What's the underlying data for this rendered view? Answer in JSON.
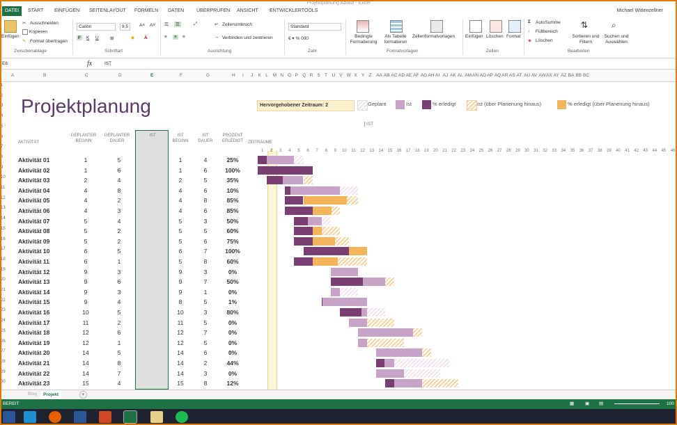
{
  "window": {
    "title": "Projektplanung Ablauf - Excel"
  },
  "tabs": [
    "DATEI",
    "START",
    "EINFÜGEN",
    "SEITENLAYOUT",
    "FORMELN",
    "DATEN",
    "ÜBERPRÜFEN",
    "ANSICHT",
    "ENTWICKLERTOOLS"
  ],
  "user": "Michael Wittenzellner",
  "ribbon": {
    "paste": "Einfügen",
    "cut": "Ausschneiden",
    "copy": "Kopieren",
    "format_painter": "Format übertragen",
    "group_clipboard": "Zwischenablage",
    "font_name": "Calibri",
    "font_size": "9,5",
    "group_font": "Schriftart",
    "wrap": "Zeilenumbruch",
    "merge": "Verbinden und zentrieren",
    "group_align": "Ausrichtung",
    "number_format": "Standard",
    "group_number": "Zahl",
    "cond_format": "Bedingte Formatierung",
    "as_table": "Als Tabelle formatieren",
    "cell_styles": "Zellenformatvorlagen",
    "group_styles": "Formatvorlagen",
    "insert": "Einfügen",
    "delete": "Löschen",
    "format": "Format",
    "group_cells": "Zellen",
    "autosum": "AutoSumme",
    "fill": "Füllbereich",
    "clear": "Löschen",
    "sort": "Sortieren und Filtern",
    "find": "Suchen und Auswählen",
    "group_edit": "Bearbeiten"
  },
  "formula_bar": {
    "name_box": "E6",
    "fx": "fx",
    "content": "IST"
  },
  "columns": [
    "A",
    "B",
    "C",
    "D",
    "E",
    "F",
    "G",
    "H",
    "I",
    "J",
    "K",
    "L",
    "M",
    "N",
    "O",
    "P",
    "Q",
    "R",
    "S",
    "T",
    "U",
    "V",
    "W",
    "X",
    "Y",
    "Z",
    "AA",
    "AB",
    "AC",
    "AD",
    "AE",
    "AF",
    "AG",
    "AH",
    "AI",
    "AJ",
    "AK",
    "AL",
    "AM",
    "AN",
    "AO",
    "AP",
    "AQ",
    "AR",
    "AS",
    "AT",
    "AU",
    "AV",
    "AW",
    "AX",
    "AY",
    "AZ",
    "BA",
    "BB",
    "BC"
  ],
  "rows": [
    "1",
    "2",
    "3",
    "4",
    "5",
    "6",
    "7",
    "8",
    "9",
    "10",
    "11",
    "12",
    "13",
    "14",
    "15",
    "16",
    "17",
    "18",
    "19",
    "20",
    "21",
    "22",
    "23",
    "24",
    "25",
    "26",
    "27",
    "28",
    "29",
    "30"
  ],
  "sheet": {
    "title": "Projektplanung",
    "highlight_label": "Hervorgehobener Zeitraum:",
    "highlight_value": "2",
    "legend": {
      "planned": "Geplant",
      "actual": "Ist",
      "done": "% erledigt",
      "actual_over": "Ist (über Planenung hinaus)",
      "done_over": "% erledigt (über Planenung hinaus)"
    },
    "ist_marker": "IST",
    "headers": {
      "activity": "AKTIVITÄT",
      "plan_start": "GEPLANTER BEGINN",
      "plan_dur": "GEPLANTER DAUER",
      "ist": "IST",
      "ist_start": "IST BEGINN",
      "ist_dur": "IST DAUER",
      "pct": "PROZENT ERLEDIGT",
      "periods": "ZEITRÄUME"
    },
    "periods": [
      "1",
      "2",
      "3",
      "4",
      "5",
      "6",
      "7",
      "8",
      "9",
      "10",
      "11",
      "12",
      "13",
      "14",
      "15",
      "16",
      "17",
      "18",
      "19",
      "20",
      "21",
      "22",
      "23",
      "24",
      "25",
      "26",
      "27",
      "28",
      "29",
      "30",
      "31",
      "32",
      "33",
      "34",
      "35",
      "36",
      "37",
      "38",
      "39",
      "40",
      "41",
      "42",
      "43",
      "44",
      "45",
      "46"
    ],
    "activities": [
      {
        "name": "Aktivität 01",
        "ps": "1",
        "pd": "5",
        "is": "1",
        "id": "4",
        "pct": "25%"
      },
      {
        "name": "Aktivität 02",
        "ps": "1",
        "pd": "6",
        "is": "1",
        "id": "6",
        "pct": "100%"
      },
      {
        "name": "Aktivität 03",
        "ps": "2",
        "pd": "4",
        "is": "2",
        "id": "5",
        "pct": "35%"
      },
      {
        "name": "Aktivität 04",
        "ps": "4",
        "pd": "8",
        "is": "4",
        "id": "6",
        "pct": "10%"
      },
      {
        "name": "Aktivität 05",
        "ps": "4",
        "pd": "2",
        "is": "4",
        "id": "8",
        "pct": "85%"
      },
      {
        "name": "Aktivität 06",
        "ps": "4",
        "pd": "3",
        "is": "4",
        "id": "6",
        "pct": "85%"
      },
      {
        "name": "Aktivität 07",
        "ps": "5",
        "pd": "4",
        "is": "5",
        "id": "3",
        "pct": "50%"
      },
      {
        "name": "Aktivität 08",
        "ps": "5",
        "pd": "2",
        "is": "5",
        "id": "5",
        "pct": "60%"
      },
      {
        "name": "Aktivität 09",
        "ps": "5",
        "pd": "2",
        "is": "5",
        "id": "6",
        "pct": "75%"
      },
      {
        "name": "Aktivität 10",
        "ps": "6",
        "pd": "5",
        "is": "6",
        "id": "7",
        "pct": "100%"
      },
      {
        "name": "Aktivität 11",
        "ps": "6",
        "pd": "1",
        "is": "5",
        "id": "8",
        "pct": "60%"
      },
      {
        "name": "Aktivität 12",
        "ps": "9",
        "pd": "3",
        "is": "9",
        "id": "3",
        "pct": "0%"
      },
      {
        "name": "Aktivität 13",
        "ps": "9",
        "pd": "6",
        "is": "9",
        "id": "7",
        "pct": "50%"
      },
      {
        "name": "Aktivität 14",
        "ps": "9",
        "pd": "3",
        "is": "9",
        "id": "1",
        "pct": "0%"
      },
      {
        "name": "Aktivität 15",
        "ps": "9",
        "pd": "4",
        "is": "8",
        "id": "5",
        "pct": "1%"
      },
      {
        "name": "Aktivität 16",
        "ps": "10",
        "pd": "5",
        "is": "10",
        "id": "3",
        "pct": "80%"
      },
      {
        "name": "Aktivität 17",
        "ps": "11",
        "pd": "2",
        "is": "11",
        "id": "5",
        "pct": "0%"
      },
      {
        "name": "Aktivität 18",
        "ps": "12",
        "pd": "6",
        "is": "12",
        "id": "7",
        "pct": "0%"
      },
      {
        "name": "Aktivität 19",
        "ps": "12",
        "pd": "1",
        "is": "12",
        "id": "5",
        "pct": "0%"
      },
      {
        "name": "Aktivität 20",
        "ps": "14",
        "pd": "5",
        "is": "14",
        "id": "6",
        "pct": "0%"
      },
      {
        "name": "Aktivität 21",
        "ps": "14",
        "pd": "8",
        "is": "14",
        "id": "2",
        "pct": "44%"
      },
      {
        "name": "Aktivität 22",
        "ps": "14",
        "pd": "7",
        "is": "14",
        "id": "3",
        "pct": "0%"
      },
      {
        "name": "Aktivität 23",
        "ps": "15",
        "pd": "4",
        "is": "15",
        "id": "8",
        "pct": "12%"
      }
    ]
  },
  "sheet_tabs": {
    "other": "Blog",
    "active": "Projekt",
    "add": "+"
  },
  "status": {
    "ready": "BEREIT",
    "zoom": "100"
  },
  "colors": {
    "accent": "#1e7145",
    "title": "#5b3a6b",
    "done": "#7a3f72",
    "actual": "#c7a3c8",
    "planned": "#d8c2dc",
    "over": "#f3b45a"
  }
}
